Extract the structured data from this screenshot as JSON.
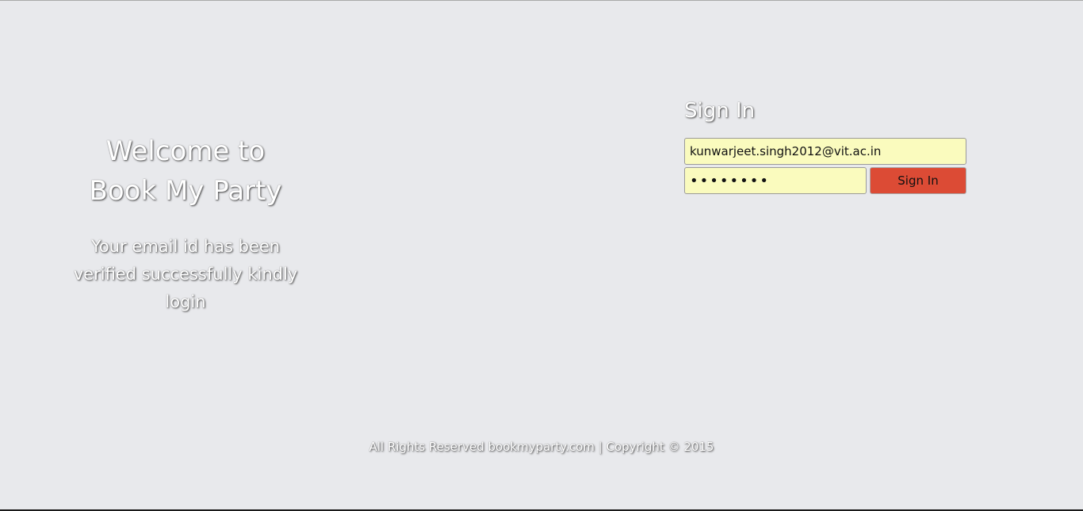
{
  "hero": {
    "welcome_line1": "Welcome to",
    "welcome_line2": "Book My Party",
    "message": "Your email id has been verified successfully kindly login"
  },
  "signin": {
    "title": "Sign In",
    "email_value": "kunwarjeet.singh2012@vit.ac.in",
    "password_value": "12345678",
    "button_label": "Sign In"
  },
  "footer": {
    "text": "All Rights Reserved bookmyparty.com | Copyright © 2015"
  },
  "colors": {
    "background": "#e8e9ec",
    "input_background": "#fafbbe",
    "button_background": "#dc4b35"
  }
}
